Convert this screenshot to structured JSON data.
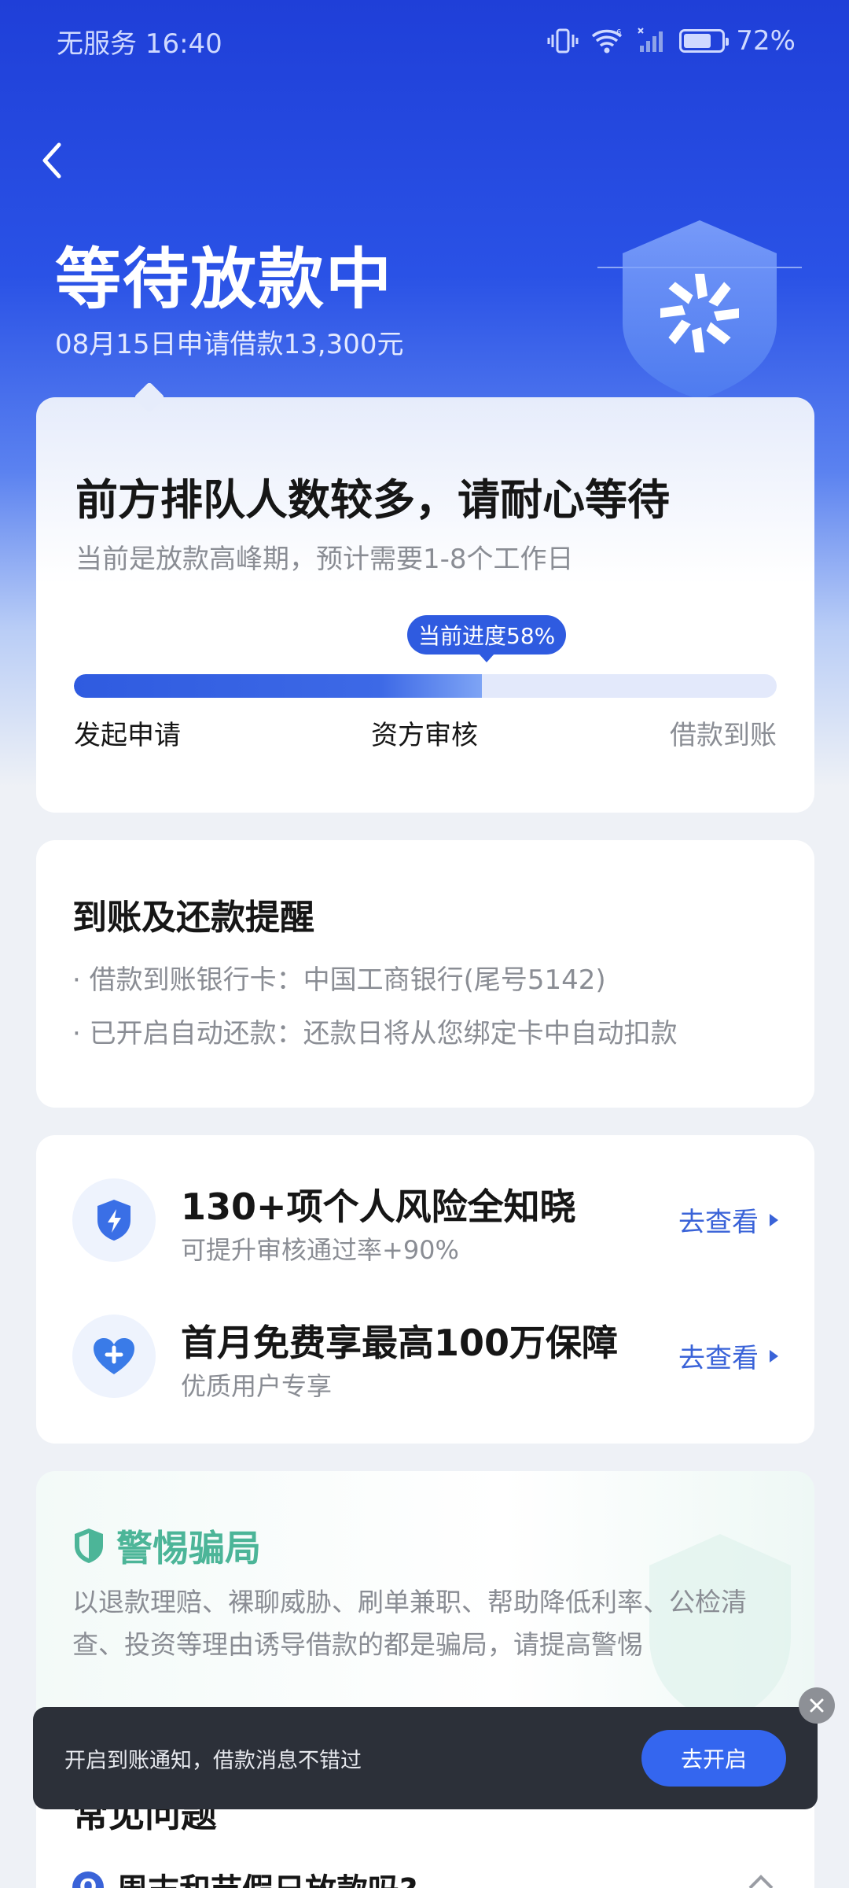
{
  "status_bar": {
    "left": "无服务 16:40",
    "battery": "72%",
    "battery_level": 0.72,
    "icons": [
      "vibrate-icon",
      "wifi-icon",
      "signal-icon",
      "battery-icon"
    ]
  },
  "header": {
    "back_icon": "chevron-left-icon",
    "title": "等待放款中",
    "subtitle": "08月15日申请借款13,300元",
    "badge_icon": "shield-logo-icon"
  },
  "progress_card": {
    "title": "前方排队人数较多，请耐心等待",
    "subtitle": "当前是放款高峰期，预计需要1-8个工作日",
    "tip": "当前进度58%",
    "progress": 0.58,
    "steps": [
      "发起申请",
      "资方审核",
      "借款到账"
    ]
  },
  "reminder": {
    "title": "到账及还款提醒",
    "lines": [
      "· 借款到账银行卡：中国工商银行(尾号5142)",
      "· 已开启自动还款：还款日将从您绑定卡中自动扣款"
    ]
  },
  "promos": [
    {
      "icon": "shield-lightning-icon",
      "title": "130+项个人风险全知晓",
      "subtitle": "可提升审核通过率+90%",
      "link": "去查看"
    },
    {
      "icon": "heart-plus-icon",
      "title": "首月免费享最高100万保障",
      "subtitle": "优质用户专享",
      "link": "去查看"
    }
  ],
  "warning": {
    "icon": "shield-check-icon",
    "title": "警惕骗局",
    "body": "以退款理赔、裸聊威胁、刷单兼职、帮助降低利率、公检清查、投资等理由诱导借款的都是骗局，请提高警惕"
  },
  "faq": {
    "title": "常见问题",
    "question_badge": "Q",
    "question": "周末和节假日放款吗?"
  },
  "toast": {
    "text": "开启到账通知，借款消息不错过",
    "button": "去开启",
    "close_icon": "close-icon"
  },
  "colors": {
    "brand_blue": "#2f5be0",
    "warning_green": "#4cb598",
    "toast_bg": "#2c3039"
  }
}
